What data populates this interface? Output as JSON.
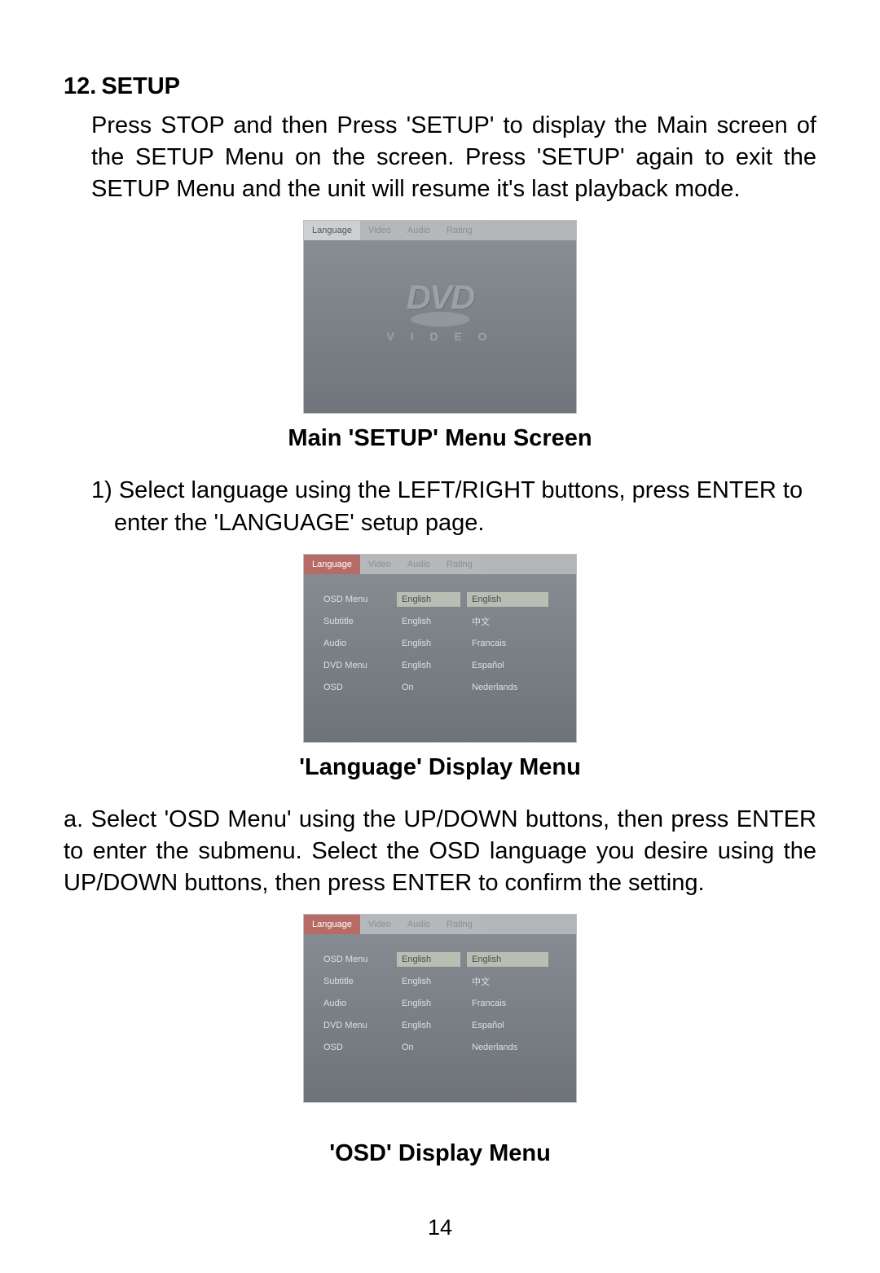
{
  "heading": {
    "number": "12.",
    "title": "SETUP"
  },
  "para1": "Press STOP and then Press 'SETUP' to display the Main screen of the SETUP Menu on the screen. Press 'SETUP' again to exit  the SETUP Menu and the unit  will resume it's last playback mode.",
  "caption1": "Main 'SETUP' Menu Screen",
  "step1": "1) Select language using the LEFT/RIGHT buttons,  press ENTER to enter the 'LANGUAGE' setup page.",
  "caption2": "'Language' Display Menu",
  "para_a": "a. Select 'OSD Menu' using the UP/DOWN buttons, then press ENTER to enter  the submenu. Select  the OSD  language you desire using  the UP/DOWN buttons, then press ENTER to confirm the setting.",
  "caption3": "'OSD' Display Menu",
  "page_number": "14",
  "screen1": {
    "tabs": [
      "Language",
      "Video",
      "Audio",
      "Rating"
    ],
    "dvd_logo": "DVD",
    "dvd_sub": "V I D E O"
  },
  "screen2": {
    "tabs": [
      "Language",
      "Video",
      "Audio",
      "Rating"
    ],
    "rows": {
      "labels": [
        "OSD Menu",
        "Subtitle",
        "Audio",
        "DVD Menu",
        "OSD"
      ],
      "values": [
        "English",
        "English",
        "English",
        "English",
        "On"
      ],
      "options": [
        "English",
        "中文",
        "Francais",
        "Español",
        "Nederlands"
      ]
    }
  },
  "screen3": {
    "tabs": [
      "Language",
      "Video",
      "Audio",
      "Rating"
    ],
    "rows": {
      "labels": [
        "OSD Menu",
        "Subtitle",
        "Audio",
        "DVD Menu",
        "OSD"
      ],
      "values": [
        "English",
        "English",
        "English",
        "English",
        "On"
      ],
      "options": [
        "English",
        "中文",
        "Francais",
        "Español",
        "Nederlands"
      ]
    }
  }
}
